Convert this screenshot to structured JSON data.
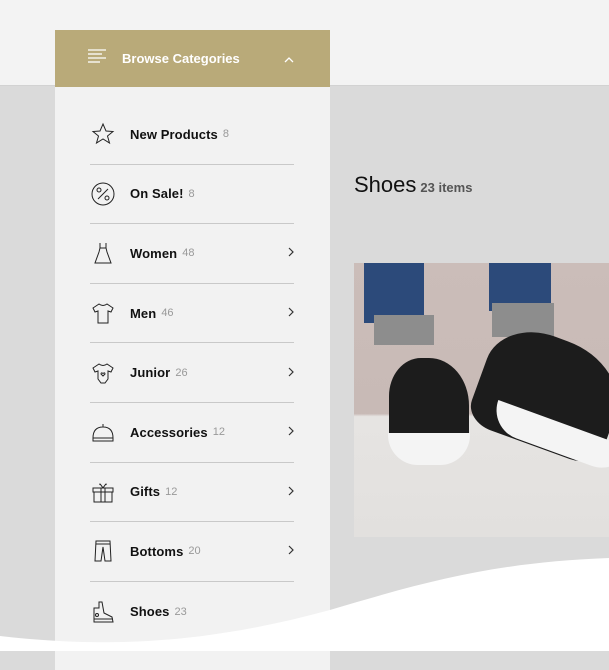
{
  "menu": {
    "title": "Browse Categories",
    "icon": "hamburger-icon",
    "toggle_icon": "chevron-up-icon",
    "items": [
      {
        "label": "New Products",
        "count": "8",
        "icon": "star-icon",
        "submenu": false
      },
      {
        "label": "On Sale!",
        "count": "8",
        "icon": "percent-icon",
        "submenu": false
      },
      {
        "label": "Women",
        "count": "48",
        "icon": "dress-icon",
        "submenu": true
      },
      {
        "label": "Men",
        "count": "46",
        "icon": "tshirt-icon",
        "submenu": true
      },
      {
        "label": "Junior",
        "count": "26",
        "icon": "onesie-icon",
        "submenu": true
      },
      {
        "label": "Accessories",
        "count": "12",
        "icon": "cap-icon",
        "submenu": true
      },
      {
        "label": "Gifts",
        "count": "12",
        "icon": "gift-icon",
        "submenu": true
      },
      {
        "label": "Bottoms",
        "count": "20",
        "icon": "pants-icon",
        "submenu": true
      },
      {
        "label": "Shoes",
        "count": "23",
        "icon": "sneaker-icon",
        "submenu": false
      }
    ]
  },
  "main": {
    "title": "Shoes",
    "count": "23 items"
  },
  "colors": {
    "accent": "#b9aa79",
    "panel": "#f2f2f2",
    "background": "#dadada"
  }
}
